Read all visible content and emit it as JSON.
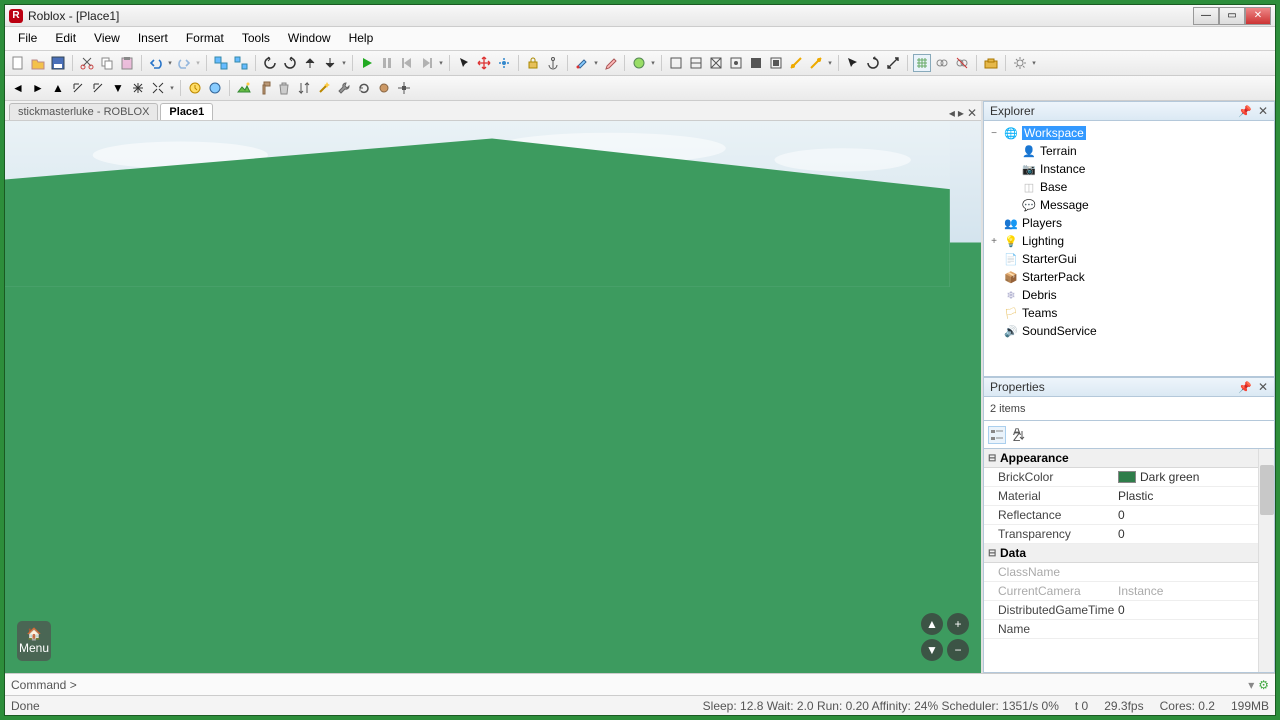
{
  "window": {
    "title": "Roblox - [Place1]"
  },
  "menus": [
    "File",
    "Edit",
    "View",
    "Insert",
    "Format",
    "Tools",
    "Window",
    "Help"
  ],
  "tabs": {
    "inactive": "stickmasterluke - ROBLOX",
    "active": "Place1"
  },
  "hud": {
    "menu": "Menu"
  },
  "explorer": {
    "title": "Explorer",
    "items": [
      {
        "label": "Workspace",
        "indent": 0,
        "selected": true,
        "toggle": "−",
        "icon": "globe",
        "color": "#3aa3e3"
      },
      {
        "label": "Terrain",
        "indent": 1,
        "icon": "terrain",
        "color": "#4caf50"
      },
      {
        "label": "Instance",
        "indent": 1,
        "icon": "camera",
        "color": "#888"
      },
      {
        "label": "Base",
        "indent": 1,
        "icon": "part",
        "color": "#bbb"
      },
      {
        "label": "Message",
        "indent": 1,
        "icon": "message",
        "color": "#ddd"
      },
      {
        "label": "Players",
        "indent": 0,
        "icon": "players",
        "color": "#4caf50"
      },
      {
        "label": "Lighting",
        "indent": 0,
        "toggle": "+",
        "icon": "lighting",
        "color": "#66aadd"
      },
      {
        "label": "StarterGui",
        "indent": 0,
        "icon": "gui",
        "color": "#e8c060"
      },
      {
        "label": "StarterPack",
        "indent": 0,
        "icon": "pack",
        "color": "#e8c060"
      },
      {
        "label": "Debris",
        "indent": 0,
        "icon": "debris",
        "color": "#aac"
      },
      {
        "label": "Teams",
        "indent": 0,
        "icon": "teams",
        "color": "#e8c060"
      },
      {
        "label": "SoundService",
        "indent": 0,
        "icon": "sound",
        "color": "#888"
      }
    ]
  },
  "properties": {
    "title": "Properties",
    "summary": "2 items",
    "groups": [
      {
        "name": "Appearance",
        "rows": [
          {
            "name": "BrickColor",
            "value": "Dark green",
            "swatch": "#2f7d4a"
          },
          {
            "name": "Material",
            "value": "Plastic"
          },
          {
            "name": "Reflectance",
            "value": "0"
          },
          {
            "name": "Transparency",
            "value": "0"
          }
        ]
      },
      {
        "name": "Data",
        "rows": [
          {
            "name": "ClassName",
            "value": "",
            "readonly": true
          },
          {
            "name": "CurrentCamera",
            "value": "Instance",
            "readonly": true
          },
          {
            "name": "DistributedGameTime",
            "value": "0"
          },
          {
            "name": "Name",
            "value": ""
          }
        ]
      }
    ]
  },
  "command": {
    "prompt": "Command >"
  },
  "status": {
    "left": "Done",
    "perf": "Sleep: 12.8 Wait: 2.0 Run: 0.20 Affinity: 24% Scheduler: 1351/s 0%",
    "t": "t 0",
    "fps": "29.3fps",
    "cores": "Cores: 0.2",
    "mem": "199MB"
  },
  "icons": {
    "play": "#2a2",
    "arrow": "#333"
  }
}
